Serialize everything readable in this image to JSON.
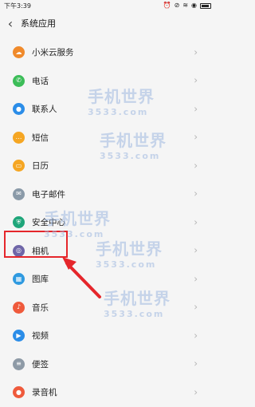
{
  "status": {
    "time": "下午3:39"
  },
  "header": {
    "title": "系统应用"
  },
  "items": [
    {
      "label": "小米云服务",
      "color": "#f08a2b",
      "icon": "cloud-icon"
    },
    {
      "label": "电话",
      "color": "#3cbd58",
      "icon": "phone-icon"
    },
    {
      "label": "联系人",
      "color": "#2b8de8",
      "icon": "contact-icon"
    },
    {
      "label": "短信",
      "color": "#f5a623",
      "icon": "message-icon"
    },
    {
      "label": "日历",
      "color": "#f5a623",
      "icon": "calendar-icon"
    },
    {
      "label": "电子邮件",
      "color": "#8a9aa8",
      "icon": "email-icon"
    },
    {
      "label": "安全中心",
      "color": "#1fa67a",
      "icon": "shield-icon"
    },
    {
      "label": "相机",
      "color": "#6f66a8",
      "icon": "camera-icon"
    },
    {
      "label": "图库",
      "color": "#2f9ae0",
      "icon": "gallery-icon"
    },
    {
      "label": "音乐",
      "color": "#ef5a3c",
      "icon": "music-icon"
    },
    {
      "label": "视频",
      "color": "#2b8de8",
      "icon": "video-icon"
    },
    {
      "label": "便签",
      "color": "#8e9aa6",
      "icon": "notes-icon"
    },
    {
      "label": "录音机",
      "color": "#ef5a3c",
      "icon": "recorder-icon"
    }
  ],
  "watermarks": [
    {
      "title": "手机世界",
      "sub": "3533.com"
    },
    {
      "title": "手机世界",
      "sub": "3533.com"
    },
    {
      "title": "手机世界",
      "sub": "3533.com"
    },
    {
      "title": "手机世界",
      "sub": "3533.com"
    },
    {
      "title": "手机世界",
      "sub": "3533.com"
    }
  ]
}
